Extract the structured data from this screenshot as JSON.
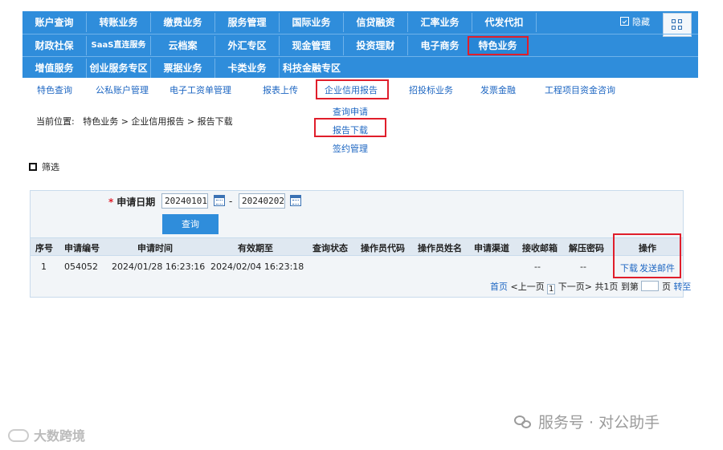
{
  "nav": {
    "row1": [
      "账户查询",
      "转账业务",
      "缴费业务",
      "服务管理",
      "国际业务",
      "信贷融资",
      "汇率业务",
      "代发代扣"
    ],
    "row2": [
      "财政社保",
      "SaaS直连服务",
      "云档案",
      "外汇专区",
      "现金管理",
      "投资理财",
      "电子商务",
      "特色业务"
    ],
    "row3": [
      "增值服务",
      "创业服务专区",
      "票据业务",
      "卡类业务",
      "科技金融专区"
    ],
    "hide_label": "隐藏"
  },
  "subnav": {
    "items": [
      "特色查询",
      "公私账户管理",
      "电子工资单管理",
      "报表上传",
      "企业信用报告",
      "招投标业务",
      "发票金融",
      "工程项目资金咨询"
    ],
    "dropdown": [
      "查询申请",
      "报告下载",
      "签约管理"
    ]
  },
  "breadcrumb": {
    "prefix": "当前位置:",
    "path": "特色业务  >  企业信用报告  >  报告下载"
  },
  "filter_label": "筛选",
  "query": {
    "required_mark": "*",
    "date_label": "申请日期",
    "start_date": "20240101",
    "date_separator": "-",
    "end_date": "20240202",
    "button": "查询"
  },
  "table": {
    "headers": [
      "序号",
      "申请编号",
      "申请时间",
      "有效期至",
      "查询状态",
      "操作员代码",
      "操作员姓名",
      "申请渠道",
      "接收邮箱",
      "解压密码",
      "操作"
    ],
    "row": {
      "index": "1",
      "app_no": "054052",
      "app_time": "2024/01/28  16:23:16",
      "valid_until": "2024/02/04  16:23:18",
      "email": "--",
      "password": "--",
      "download": "下载",
      "send_mail": "发送邮件"
    }
  },
  "pager": {
    "first": "首页",
    "prev": "<上一页",
    "page": "1",
    "next": "下一页>",
    "total": "共1页",
    "goto_prefix": "到第",
    "goto_suffix": "页",
    "goto": "转至"
  },
  "watermark": {
    "left": "大数跨境",
    "right": "服务号 · 对公助手"
  },
  "colors": {
    "nav_bg": "#2f8ddb",
    "highlight_red": "#e01e2b",
    "link_blue": "#1d66c2"
  }
}
